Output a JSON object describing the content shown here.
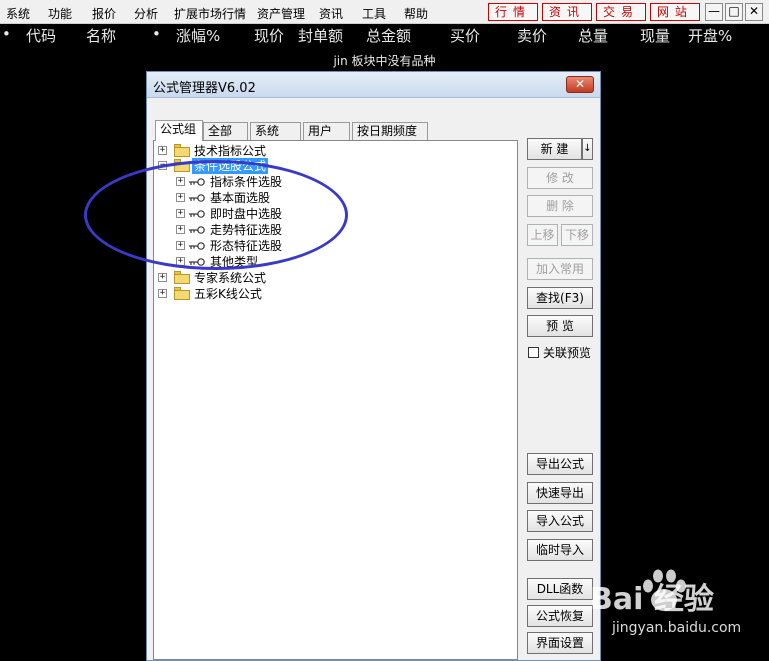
{
  "menubar": {
    "items": [
      "系统",
      "功能",
      "报价",
      "分析",
      "扩展市场行情",
      "资产管理",
      "资讯",
      "工具",
      "帮助"
    ],
    "quick_buttons": [
      "行情",
      "资讯",
      "交易",
      "网站"
    ],
    "window_controls": [
      "—",
      "□",
      "✕"
    ]
  },
  "quote_header": {
    "columns": [
      "•",
      "代码",
      "名称",
      "•",
      "涨幅%",
      "现价",
      "封单额",
      "总金额",
      "买价",
      "卖价",
      "总量",
      "现量",
      "开盘%"
    ],
    "notice": "jin 板块中没有品种"
  },
  "dialog": {
    "title": "公式管理器V6.02",
    "close_label": "✕",
    "tabs": [
      "公式组",
      "全部",
      "系统",
      "用户",
      "按日期频度"
    ],
    "tree": [
      {
        "label": "技术指标公式",
        "level": 0,
        "icon": "folder-icon",
        "expander": "+"
      },
      {
        "label": "条件选股公式",
        "level": 0,
        "icon": "folder-icon",
        "expander": "−",
        "selected": true
      },
      {
        "label": "指标条件选股",
        "level": 1,
        "icon": "key-icon",
        "expander": "+"
      },
      {
        "label": "基本面选股",
        "level": 1,
        "icon": "key-icon",
        "expander": "+"
      },
      {
        "label": "即时盘中选股",
        "level": 1,
        "icon": "key-icon",
        "expander": "+"
      },
      {
        "label": "走势特征选股",
        "level": 1,
        "icon": "key-icon",
        "expander": "+"
      },
      {
        "label": "形态特征选股",
        "level": 1,
        "icon": "key-icon",
        "expander": "+"
      },
      {
        "label": "其他类型",
        "level": 1,
        "icon": "key-icon",
        "expander": "+"
      },
      {
        "label": "专家系统公式",
        "level": 0,
        "icon": "folder-icon",
        "expander": "+"
      },
      {
        "label": "五彩K线公式",
        "level": 0,
        "icon": "folder-icon",
        "expander": "+"
      }
    ],
    "buttons": {
      "new": "新 建",
      "new_arrow": "↓",
      "modify": "修 改",
      "delete": "删 除",
      "move_up": "上移",
      "move_down": "下移",
      "add_common": "加入常用",
      "find": "查找(F3)",
      "preview": "预 览",
      "export_formula": "导出公式",
      "quick_export": "快速导出",
      "import_formula": "导入公式",
      "temp_import": "临时导入",
      "dll_function": "DLL函数",
      "restore_formula": "公式恢复",
      "ui_settings": "界面设置"
    },
    "linked_preview_label": "关联预览",
    "linked_preview_checked": false
  },
  "watermark": {
    "logo": "Bai  经验",
    "subtext": "jingyan.baidu.com"
  },
  "colors": {
    "background": "#000000",
    "header_text": "#e8e8e8",
    "quick_button_red": "#cc0000",
    "selection": "#3399ff",
    "annotation_circle": "#3a3ac9"
  }
}
